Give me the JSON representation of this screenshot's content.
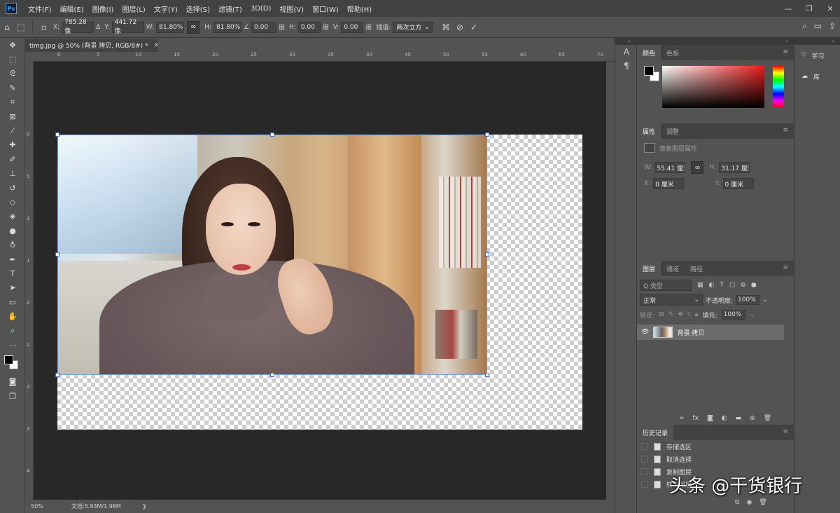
{
  "menubar": {
    "logo": "Ps",
    "items": [
      "文件(F)",
      "编辑(E)",
      "图像(I)",
      "图层(L)",
      "文字(Y)",
      "选择(S)",
      "滤镜(T)",
      "3D(D)",
      "视图(V)",
      "窗口(W)",
      "帮助(H)"
    ],
    "window_controls": [
      "—",
      "❐",
      "✕"
    ]
  },
  "options": {
    "x_label": "X:",
    "x_value": "785.28 像",
    "y_label": "Y:",
    "y_value": "441.72 像",
    "w_label": "W:",
    "w_value": "81.80%",
    "h_label": "H:",
    "h_value": "81.80%",
    "angle_value": "0.00",
    "angle_unit": "度",
    "hskew_label": "H:",
    "hskew_value": "0.00",
    "hskew_unit": "度",
    "vskew_label": "V:",
    "vskew_value": "0.00",
    "vskew_unit": "度",
    "interp_label": "插值:",
    "interp_value": "两次立方"
  },
  "document": {
    "tab_title": "timg.jpg @ 50% (背景 拷贝, RGB/8#) *",
    "ruler_h_ticks": [
      "0",
      "5",
      "10",
      "15",
      "20",
      "25",
      "30",
      "35",
      "40",
      "45",
      "50",
      "55",
      "60",
      "65",
      "70",
      "75"
    ],
    "ruler_v_ticks": [
      "0",
      "5",
      "1",
      "1",
      "2",
      "2",
      "3",
      "3",
      "4"
    ],
    "zoom": "50%",
    "doc_info": "文档:5.93M/1.98M"
  },
  "panels": {
    "color": {
      "tab_active": "颜色",
      "tab_other": "色板"
    },
    "properties": {
      "tab_active": "属性",
      "tab_other": "调整",
      "subtitle": "像素图层属性",
      "w_label": "W:",
      "w_value": "55.41 厘米",
      "h_label": "H:",
      "h_value": "31.17 厘米",
      "x_label": "X:",
      "x_value": "0 厘米",
      "y_label": "Y:",
      "y_value": "0 厘米"
    },
    "layers": {
      "tabs": [
        "图层",
        "通道",
        "路径"
      ],
      "kind_placeholder": "Q 类型",
      "blend_mode": "正常",
      "opacity_label": "不透明度:",
      "opacity_value": "100%",
      "lock_label": "锁定:",
      "fill_label": "填充:",
      "fill_value": "100%",
      "layer_name": "背景 拷贝"
    },
    "history": {
      "tab": "历史记录",
      "items": [
        "存储选区",
        "取消选择",
        "复制图层",
        "转为图层",
        ""
      ]
    }
  },
  "right_column": {
    "learn": "学习",
    "libraries": "库"
  },
  "watermark": "头条 @干货银行",
  "colors": {
    "accent": "#31a8ff",
    "bg_panel": "#535353",
    "bg_dark": "#424242",
    "pasteboard": "#282828"
  }
}
